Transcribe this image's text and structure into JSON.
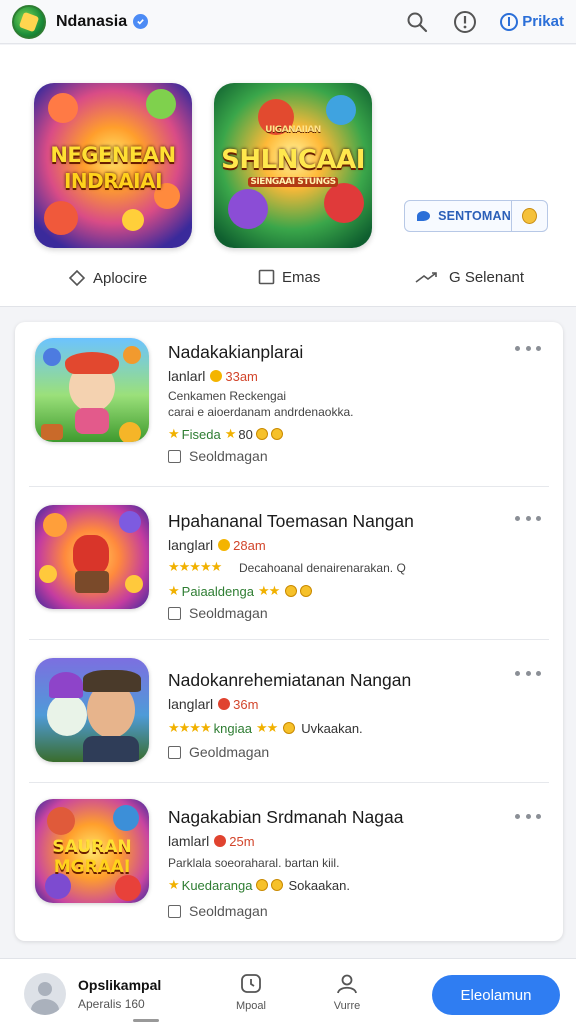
{
  "header": {
    "app_name": "Ndanasia",
    "link_label": "Prikat",
    "icons": [
      "app-logo-icon",
      "verified-icon",
      "search-icon",
      "alert-icon",
      "info-icon"
    ]
  },
  "featured": {
    "tiles": [
      {
        "line1": "NEGENEAN",
        "line2": "INDRAIAI"
      },
      {
        "small": "UIGANAIIAN",
        "line1": "SHLNCAAI",
        "line2": "SIENGAAI STUNGS"
      }
    ],
    "badge_label": "SENTOMAN",
    "nav": [
      {
        "label": "Aplocire",
        "icon": "tag-icon"
      },
      {
        "label": "Emas",
        "icon": "square-icon"
      },
      {
        "label": "G Selenant",
        "icon": "share-icon"
      }
    ]
  },
  "apps": [
    {
      "title": "Nadakakianplarai",
      "sub_label": "lanlarl",
      "size": "33am",
      "desc_1": "Cenkamen Reckengai",
      "desc_2": "carai e aioerdanam andrdenaokka.",
      "rating_text": "Fiseda",
      "rating_tail": "80",
      "check_label": "Seoldmagan"
    },
    {
      "title": "Hpahananal  Toemasan Nangan",
      "sub_label": "langlarl",
      "size": "28am",
      "desc_1": "Decahoanal denairenarakan. Q",
      "desc_2": "",
      "rating_text": "Paiaaldenga",
      "rating_tail": "",
      "check_label": "Seoldmagan"
    },
    {
      "title": "Nadokanrehemiatanan Nangan",
      "sub_label": "langlarl",
      "size": "36m",
      "desc_1": "",
      "desc_2": "",
      "rating_text": "kngiaa",
      "rating_tail": "Uvkaakan.",
      "check_label": "Geoldmagan"
    },
    {
      "title": "Nagakabian Srdmanah Nagaa",
      "sub_label": "lamlarl",
      "size": "25m",
      "desc_1": "Parklala soeoraharal. bartan kiil.",
      "desc_2": "",
      "rating_text": "Kuedaranga",
      "rating_tail": "Sokaakan.",
      "check_label": "Seoldmagan"
    }
  ],
  "bottom": {
    "user_name": "Opslikampal",
    "user_sub": "Aperalis 160",
    "tabs": [
      {
        "label": "Mpoal",
        "icon": "clock-icon"
      },
      {
        "label": "Vurre",
        "icon": "profile-icon"
      }
    ],
    "cta_label": "Eleolamun"
  },
  "colors": {
    "accent": "#2f7df2",
    "size_text": "#d2452b",
    "star": "#f1b100",
    "rating_text": "#2e7d32"
  }
}
